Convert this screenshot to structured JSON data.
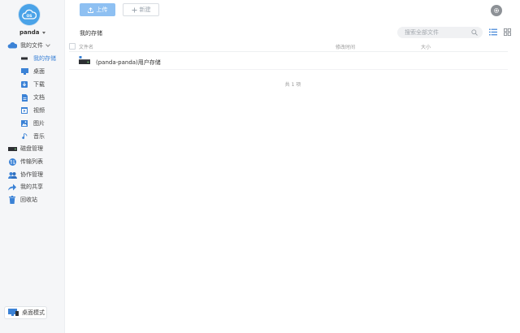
{
  "sidebar": {
    "logo_icon": "cloud-os-logo",
    "username": "panda",
    "my_files": "我的文件",
    "items": [
      {
        "label": "我的存储",
        "icon": "storage-icon",
        "active": true
      },
      {
        "label": "桌面",
        "icon": "desktop-icon"
      },
      {
        "label": "下载",
        "icon": "download-icon"
      },
      {
        "label": "文档",
        "icon": "document-icon"
      },
      {
        "label": "视频",
        "icon": "video-icon"
      },
      {
        "label": "图片",
        "icon": "image-icon"
      },
      {
        "label": "音乐",
        "icon": "music-icon"
      }
    ],
    "sections": [
      {
        "label": "磁盘管理",
        "icon": "disk-icon"
      },
      {
        "label": "传输列表",
        "icon": "transfer-icon"
      },
      {
        "label": "协作管理",
        "icon": "collaboration-icon"
      },
      {
        "label": "我的共享",
        "icon": "share-icon"
      },
      {
        "label": "回收站",
        "icon": "trash-icon"
      }
    ],
    "desktop_mode": "桌面模式"
  },
  "toolbar": {
    "upload_label": "上传",
    "new_label": "新建"
  },
  "breadcrumb": "我的存储",
  "search": {
    "placeholder": "搜索全部文件"
  },
  "table": {
    "headers": {
      "name": "文件名",
      "modified": "修改时间",
      "size": "大小"
    },
    "rows": [
      {
        "name": "(panda-panda)用户存储",
        "modified": "",
        "size": ""
      }
    ]
  },
  "footer": {
    "total": "共 1 项"
  },
  "colors": {
    "accent": "#3b82d6",
    "upload_button": "#8ec0f2",
    "sidebar_bg": "#f5f6f8"
  }
}
